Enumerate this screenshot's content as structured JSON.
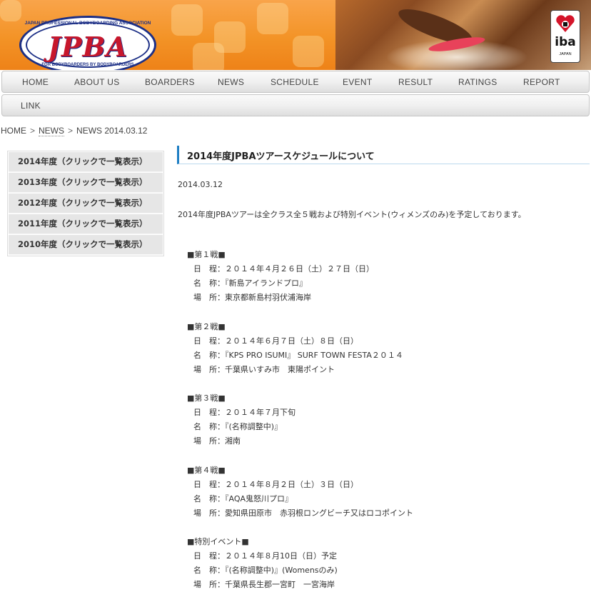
{
  "header": {
    "logo_main": "JPBA",
    "logo_top": "JAPAN PROFESSIONAL BODYBOARDING ASSOCIATION",
    "logo_bottom": "FOR BODYBOARDERS BY BODYBOARDERS",
    "badge_text": "iba",
    "badge_sub": "JAPAN",
    "brand_color": "#c7172c",
    "accent_color": "#f39326"
  },
  "nav": {
    "row1": [
      "HOME",
      "ABOUT US",
      "BOARDERS",
      "NEWS",
      "SCHEDULE",
      "EVENT",
      "RESULT",
      "RATINGS",
      "REPORT"
    ],
    "row2": [
      "LINK"
    ]
  },
  "breadcrumb": {
    "home": "HOME",
    "sep": ">",
    "news": "NEWS",
    "current": "NEWS 2014.03.12"
  },
  "sidebar": {
    "items": [
      "2014年度（クリックで一覧表示）",
      "2013年度（クリックで一覧表示）",
      "2012年度（クリックで一覧表示）",
      "2011年度（クリックで一覧表示）",
      "2010年度（クリックで一覧表示）"
    ]
  },
  "article": {
    "title": "2014年度JPBAツアースケジュールについて",
    "date": "2014.03.12",
    "intro": "2014年度JPBAツアーは全クラス全５戦および特別イベント(ウィメンズのみ)を予定しております。",
    "events": [
      {
        "heading": "■第１戦■",
        "date": "日　程：２０１４年４月２６日（土）２７日（日）",
        "name": "名　称：『新島アイランドプロ』",
        "place": "場　所：東京都新島村羽伏浦海岸"
      },
      {
        "heading": "■第２戦■",
        "date": "日　程：２０１４年６月７日（土）８日（日）",
        "name": "名　称：『KPS PRO ISUMI』 SURF TOWN FESTA２０１４",
        "place": "場　所：千葉県いすみ市　東陽ポイント"
      },
      {
        "heading": "■第３戦■",
        "date": "日　程：２０１４年７月下旬",
        "name": "名　称：『(名称調整中)』",
        "place": "場　所：湘南"
      },
      {
        "heading": "■第４戦■",
        "date": "日　程：２０１４年８月２日（土）３日（日）",
        "name": "名　称：『AQA鬼怒川プロ』",
        "place": "場　所：愛知県田原市　赤羽根ロングビーチ又はロコポイント"
      },
      {
        "heading": "■特別イベント■",
        "date": "日　程：２０１４年８月10日（日）予定",
        "name": "名　称：『(名称調整中)』(Womensのみ)",
        "place": "場　所：千葉県長生郡一宮町　一宮海岸"
      }
    ]
  }
}
